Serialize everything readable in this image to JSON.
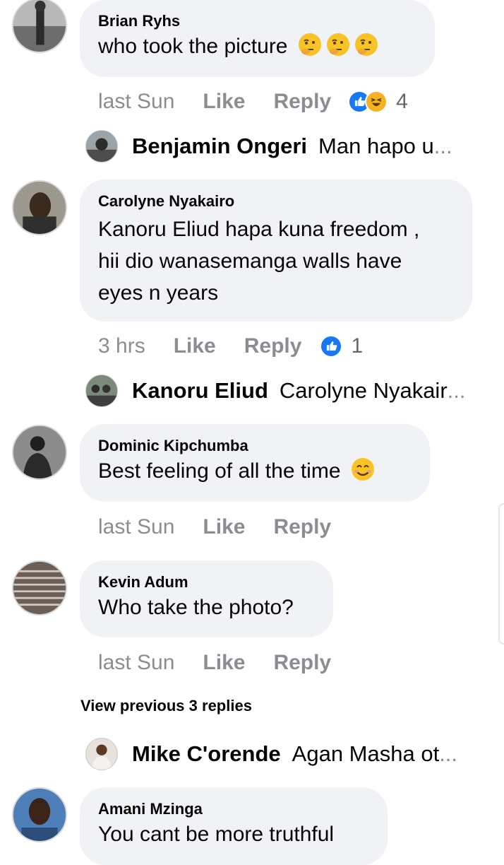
{
  "comments": [
    {
      "name": "Brian Ryhs",
      "text": "who took the picture",
      "emoji": "thinking-face",
      "time": "last Sun",
      "like_label": "Like",
      "reply_label": "Reply",
      "reaction_count": "4",
      "reply_preview": {
        "name": "Benjamin Ongeri",
        "text": "Man hapo u",
        "ellipsis": "..."
      }
    },
    {
      "name": "Carolyne Nyakairo",
      "text_lines": [
        "Kanoru Eliud hapa kuna freedom ,",
        "hii dio wanasemanga walls have",
        "eyes n years"
      ],
      "time": "3 hrs",
      "like_label": "Like",
      "reply_label": "Reply",
      "reaction_count": "1",
      "reply_preview": {
        "name": "Kanoru Eliud",
        "text": "Carolyne Nyakair",
        "ellipsis": "..."
      }
    },
    {
      "name": "Dominic Kipchumba",
      "text": "Best feeling of all the time",
      "emoji": "smiling-face",
      "time": "last Sun",
      "like_label": "Like",
      "reply_label": "Reply"
    },
    {
      "name": "Kevin Adum",
      "text": "Who take the photo?",
      "time": "last Sun",
      "like_label": "Like",
      "reply_label": "Reply",
      "view_previous": "View previous 3 replies",
      "reply_preview": {
        "name": "Mike C'orende",
        "text": "Agan Masha ot",
        "ellipsis": "..."
      }
    },
    {
      "name": "Amani Mzinga",
      "text": "You cant be more truthful"
    }
  ],
  "colors": {
    "bubble": "#f0f2f5",
    "like_blue": "#1877f2",
    "muted": "#8a8d91"
  }
}
